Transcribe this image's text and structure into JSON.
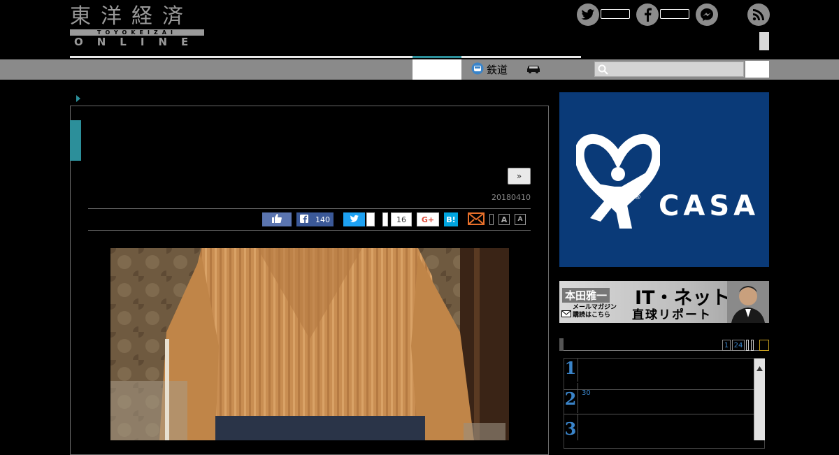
{
  "header": {
    "logo_kanji": "東洋経済",
    "logo_roman": "TOYOKEIZAI",
    "logo_online": "ONLINE",
    "social": [
      {
        "icon": "twitter-icon",
        "glyph": "t"
      },
      {
        "icon": "facebook-icon",
        "glyph": "f"
      },
      {
        "icon": "messenger-icon",
        "glyph": "~"
      },
      {
        "icon": "rss-icon",
        "glyph": ")"
      }
    ]
  },
  "nav": {
    "items": [
      {
        "label": "鉄道",
        "icon": "train-icon"
      },
      {
        "label": "",
        "icon": "car-icon"
      }
    ],
    "search_placeholder": ""
  },
  "article": {
    "next_label": "»",
    "date": "20180410",
    "share": {
      "facebook_count": "140",
      "hatena_count": "16",
      "gplus_label": "G+",
      "hatena_label": "B!",
      "font_large": "A",
      "font_small": "A"
    }
  },
  "sidebar": {
    "ad_brand": "CASA",
    "banner": {
      "author": "本田雅一",
      "title": "IT・ネット",
      "subtitle": "直球リポート",
      "mail_line1": "メールマガジン",
      "mail_line2": "購読はこちら"
    },
    "ranking": {
      "tabs": [
        "1",
        "24"
      ],
      "rows": [
        {
          "rank": "1",
          "text": ""
        },
        {
          "rank": "2",
          "text": "30"
        },
        {
          "rank": "3",
          "text": ""
        }
      ]
    }
  },
  "colors": {
    "accent": "#2c8f9a",
    "nav_bar": "#8a8a8a",
    "casa_blue": "#0a3a78",
    "rank_blue": "#3a84c9"
  }
}
